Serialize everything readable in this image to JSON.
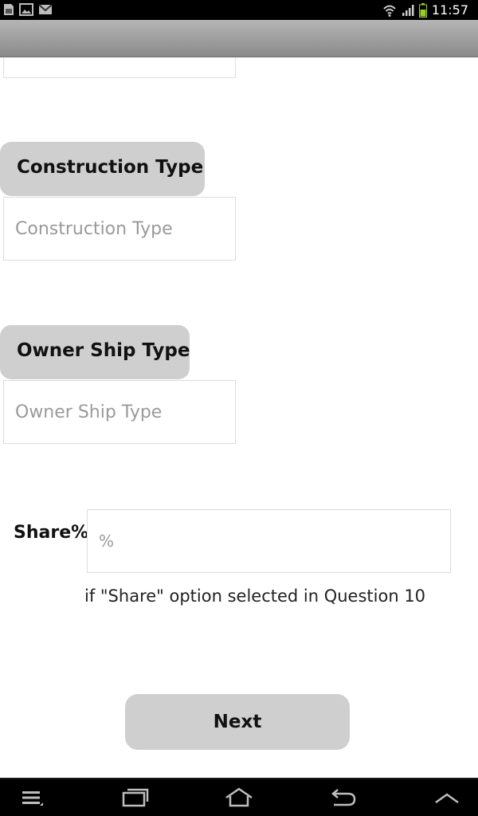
{
  "status_bar": {
    "time": "11:57",
    "left_icons": [
      "sim-card-icon",
      "image-icon",
      "gmail-icon"
    ],
    "right_icons": [
      "wifi-icon",
      "signal-icon",
      "battery-icon"
    ]
  },
  "form": {
    "construction_type": {
      "label": "Construction Type",
      "placeholder": "Construction Type",
      "value": ""
    },
    "owner_ship_type": {
      "label": "Owner Ship Type",
      "placeholder": "Owner Ship Type",
      "value": ""
    },
    "share": {
      "label": "Share%",
      "placeholder": "%",
      "value": "",
      "note": "if \"Share\" option selected in Question 10"
    },
    "next_label": "Next"
  },
  "nav_bar": {
    "icons": [
      "menu-icon",
      "recent-apps-icon",
      "home-icon",
      "back-icon",
      "chevron-up-icon"
    ]
  }
}
